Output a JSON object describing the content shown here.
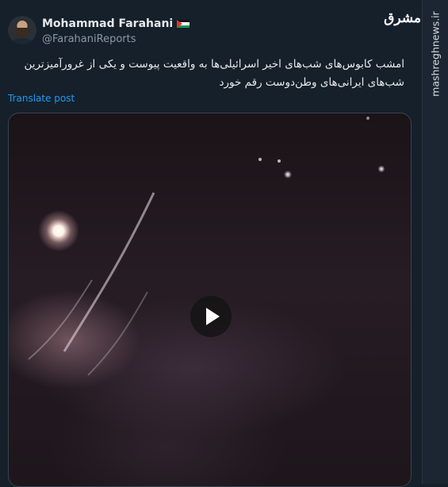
{
  "author": {
    "display_name": "Mohammad Farahani",
    "handle": "@FarahaniReports",
    "flag_icon": "palestine-flag-icon"
  },
  "tweet": {
    "text": "امشب کابوس‌های شب‌های اخیر اسرائیلی‌ها به واقعیت پیوست و یکی از غرورآمیزترین شب‌های ایرانی‌های وطن‌دوست رقم خورد",
    "translate_label": "Translate post"
  },
  "media": {
    "type": "video",
    "play_icon": "play-icon"
  },
  "branding": {
    "logo_text": "مشرق",
    "watermark": "mashreghnews.ir"
  },
  "colors": {
    "background": "#15202b",
    "link": "#1d9bf0",
    "secondary_text": "#8b98a5"
  }
}
